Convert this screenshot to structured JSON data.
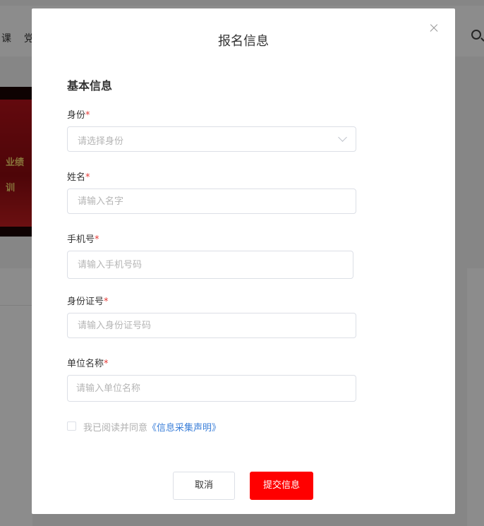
{
  "background": {
    "nav_items": [
      "课",
      "党"
    ],
    "banner_lines": [
      "业绩",
      "训"
    ]
  },
  "modal": {
    "title": "报名信息",
    "section_title": "基本信息",
    "required_mark": "*",
    "fields": [
      {
        "label": "身份",
        "placeholder": "请选择身份",
        "type": "select"
      },
      {
        "label": "姓名",
        "placeholder": "请输入名字",
        "type": "input"
      },
      {
        "label": "手机号",
        "placeholder": "请输入手机号码",
        "type": "input"
      },
      {
        "label": "身份证号",
        "placeholder": "请输入身份证号码",
        "type": "input"
      },
      {
        "label": "单位名称",
        "placeholder": "请输入单位名称",
        "type": "input"
      }
    ],
    "agreement": {
      "text": "我已阅读并同意",
      "link": "《信息采集声明》",
      "checked": false
    },
    "buttons": {
      "cancel": "取消",
      "submit": "提交信息"
    }
  },
  "colors": {
    "submit": "#ff0000",
    "required": "#e53935",
    "link": "#3b7fd9"
  }
}
